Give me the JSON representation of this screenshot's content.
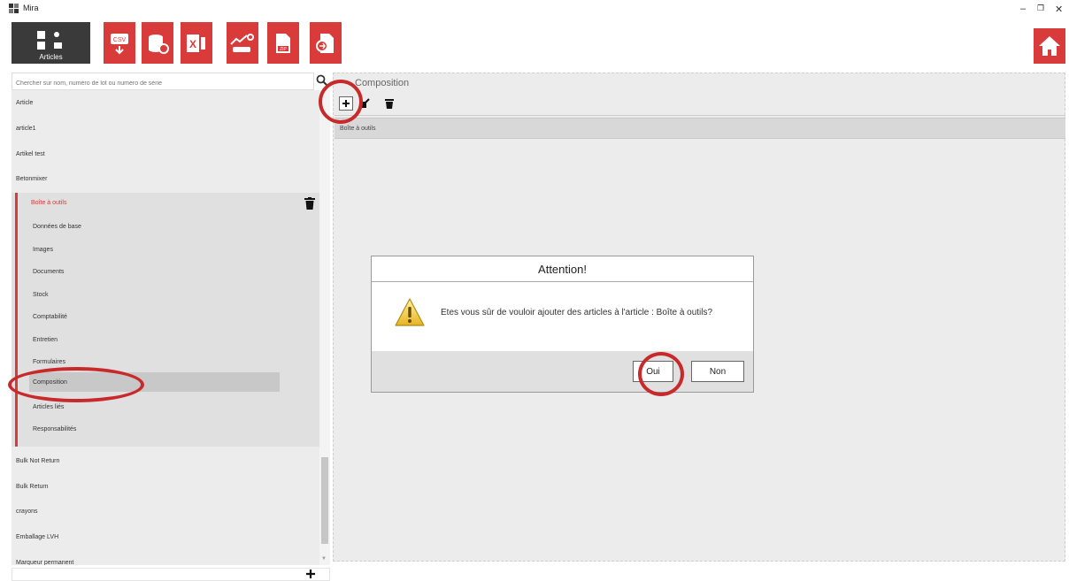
{
  "window": {
    "title": "Mira",
    "minimize": "–",
    "maximize": "❐",
    "close": "✕"
  },
  "toolbar": {
    "articles_label": "Articles",
    "buttons": [
      "csv-export-icon",
      "database-import-icon",
      "excel-icon",
      "stats-icon",
      "zip-icon",
      "document-export-icon"
    ],
    "home_icon": "home-icon",
    "accent": "#d93a3a"
  },
  "search": {
    "placeholder": "Chercher sur nom, numéro de lot ou numéro de série"
  },
  "list": {
    "items_top": [
      "Article",
      "article1",
      "Artikel test",
      "Betonmixer"
    ],
    "group": {
      "title": "Boîte à outils",
      "subitems": [
        "Données de base",
        "Images",
        "Documents",
        "Stock",
        "Comptabilité",
        "Entretien",
        "Formulaires",
        "Composition",
        "Articles liés",
        "Responsabilités"
      ],
      "selected": "Composition"
    },
    "items_bottom": [
      "Bulk Not Return",
      "Bulk Return",
      "crayons",
      "Emballage LVH",
      "Marqueur permanent"
    ]
  },
  "composition": {
    "title": "Composition",
    "row": "Boîte à outils"
  },
  "dialog": {
    "title": "Attention!",
    "message": "Etes vous sûr de vouloir ajouter des articles à l'article : Boîte à outils?",
    "yes": "Oui",
    "no": "Non"
  },
  "annotation_color": "#c8292b"
}
